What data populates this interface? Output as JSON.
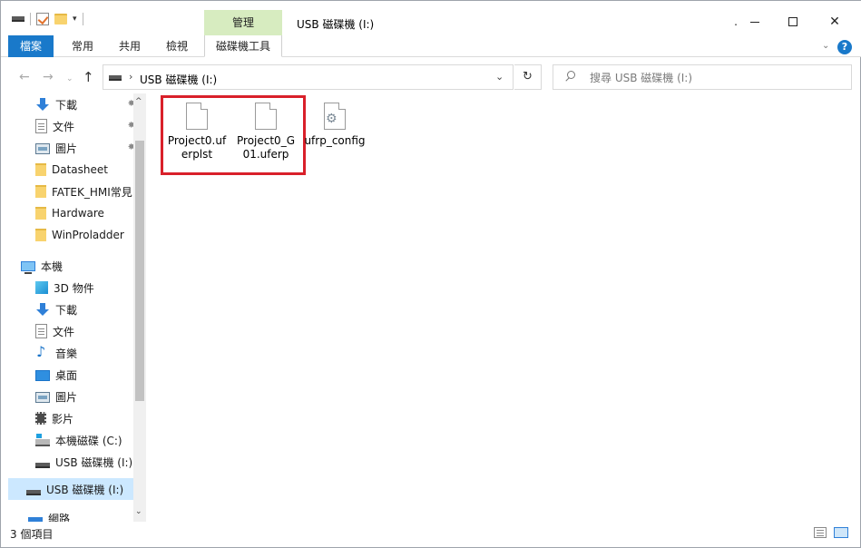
{
  "window": {
    "title": "USB 磁碟機 (I:)",
    "manage_tab": "管理",
    "dot": ".",
    "minimize": "—",
    "close": "✕"
  },
  "ribbon": {
    "tabs": [
      "檔案",
      "常用",
      "共用",
      "檢視"
    ],
    "context_tab": "磁碟機工具",
    "help": "?"
  },
  "address": {
    "path": "USB 磁碟機 (I:)",
    "search_placeholder": "搜尋 USB 磁碟機 (I:)"
  },
  "sidebar": {
    "quick_access": [
      {
        "label": "下載",
        "icon": "download-arrow-icon",
        "pinned": true
      },
      {
        "label": "文件",
        "icon": "document-icon",
        "pinned": true
      },
      {
        "label": "圖片",
        "icon": "pictures-icon",
        "pinned": true
      },
      {
        "label": "Datasheet",
        "icon": "folder-icon",
        "pinned": false
      },
      {
        "label": "FATEK_HMI常見",
        "icon": "folder-icon",
        "pinned": false
      },
      {
        "label": "Hardware",
        "icon": "folder-icon",
        "pinned": false
      },
      {
        "label": "WinProladder ",
        "icon": "folder-icon",
        "pinned": false
      }
    ],
    "this_pc": {
      "label": "本機",
      "icon": "computer-icon"
    },
    "pc_items": [
      {
        "label": "3D 物件",
        "icon": "3d-objects-icon"
      },
      {
        "label": "下載",
        "icon": "download-arrow-icon"
      },
      {
        "label": "文件",
        "icon": "document-icon"
      },
      {
        "label": "音樂",
        "icon": "music-note-icon"
      },
      {
        "label": "桌面",
        "icon": "desktop-icon"
      },
      {
        "label": "圖片",
        "icon": "pictures-icon"
      },
      {
        "label": "影片",
        "icon": "videos-icon"
      },
      {
        "label": "本機磁碟 (C:)",
        "icon": "local-disk-icon"
      },
      {
        "label": "USB 磁碟機 (I:)",
        "icon": "usb-drive-icon"
      }
    ],
    "selected": {
      "label": "USB 磁碟機 (I:)",
      "icon": "usb-drive-icon"
    },
    "network": {
      "label": "網路",
      "icon": "network-icon"
    }
  },
  "files": [
    {
      "name": "Project0.uferplst",
      "icon": "blank-file-icon"
    },
    {
      "name": "Project0_G01.uferp",
      "icon": "blank-file-icon"
    },
    {
      "name": "ufrp_config",
      "icon": "config-file-icon"
    }
  ],
  "status": {
    "item_count": "3 個項目"
  },
  "colors": {
    "accent": "#1979ca",
    "context_tab": "#d7ecc0",
    "highlight_box": "#d9202a",
    "selected": "#cce8ff"
  }
}
